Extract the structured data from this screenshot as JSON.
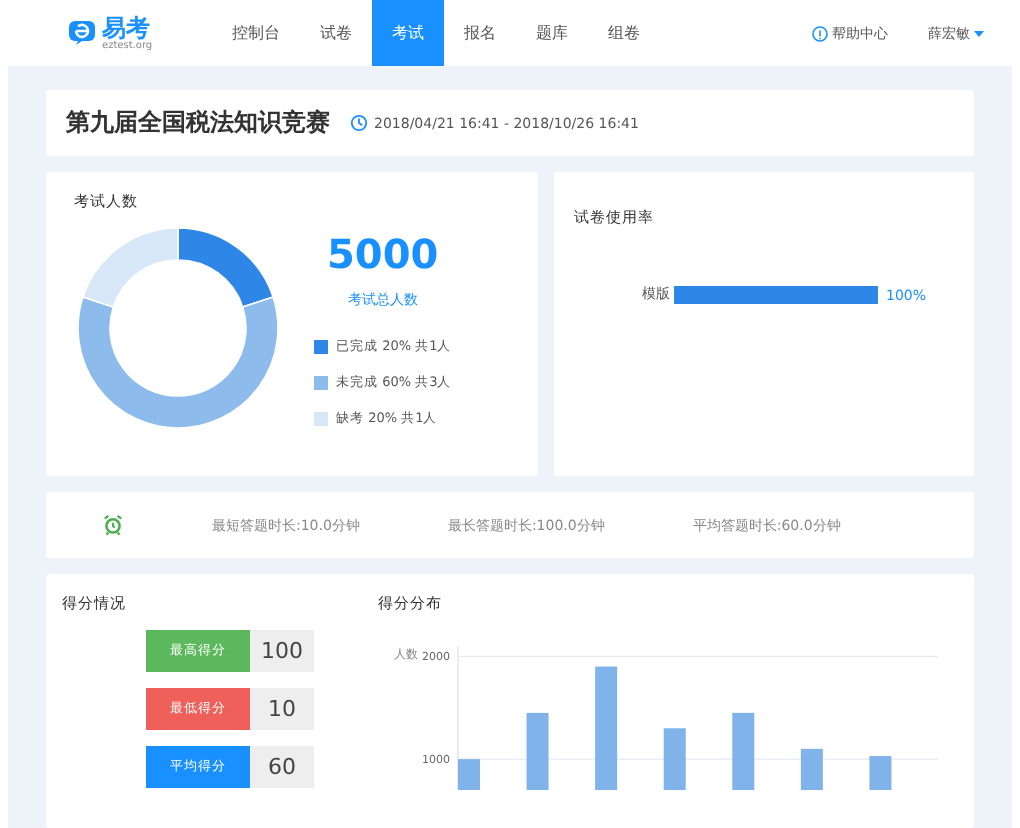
{
  "header": {
    "logo_text": "易考",
    "logo_sub": "eztest.org",
    "nav": [
      {
        "label": "控制台",
        "selected": false
      },
      {
        "label": "试卷",
        "selected": false
      },
      {
        "label": "考试",
        "selected": true
      },
      {
        "label": "报名",
        "selected": false
      },
      {
        "label": "题库",
        "selected": false
      },
      {
        "label": "组卷",
        "selected": false
      }
    ],
    "help": "帮助中心",
    "user": "薛宏敏"
  },
  "exam": {
    "title": "第九届全国税法知识竞赛",
    "period": "2018/04/21 16:41 - 2018/10/26 16:41"
  },
  "participants": {
    "title": "考试人数",
    "total": "5000",
    "total_label": "考试总人数",
    "legend": [
      {
        "label": "已完成 20% 共1人",
        "color": "#2e86e6"
      },
      {
        "label": "未完成 60% 共3人",
        "color": "#8dbbec"
      },
      {
        "label": "缺考 20% 共1人",
        "color": "#d8e7f8"
      }
    ],
    "chart_data": {
      "type": "donut",
      "values": [
        20,
        60,
        20
      ]
    }
  },
  "usage": {
    "title": "试卷使用率",
    "chart_data": {
      "type": "bar",
      "orientation": "horizontal",
      "categories": [
        "模版"
      ],
      "values": [
        100
      ],
      "value_labels": [
        "100%"
      ]
    }
  },
  "durations": [
    {
      "label": "最短答题时长:10.0分钟"
    },
    {
      "label": "最长答题时长:100.0分钟"
    },
    {
      "label": "平均答题时长:60.0分钟"
    }
  ],
  "scores": {
    "title": "得分情况",
    "items": [
      {
        "label": "最高得分",
        "value": "100",
        "color": "#5cb85c"
      },
      {
        "label": "最低得分",
        "value": "10",
        "color": "#f0605a"
      },
      {
        "label": "平均得分",
        "value": "60",
        "color": "#1890ff"
      }
    ]
  },
  "distribution": {
    "title": "得分分布",
    "chart_data": {
      "type": "bar",
      "ylabel": "人数",
      "values": [
        1000,
        1450,
        1900,
        1300,
        1450,
        1100,
        1030
      ],
      "ylim": [
        700,
        2100
      ],
      "yticks": [
        1000,
        2000
      ]
    }
  }
}
